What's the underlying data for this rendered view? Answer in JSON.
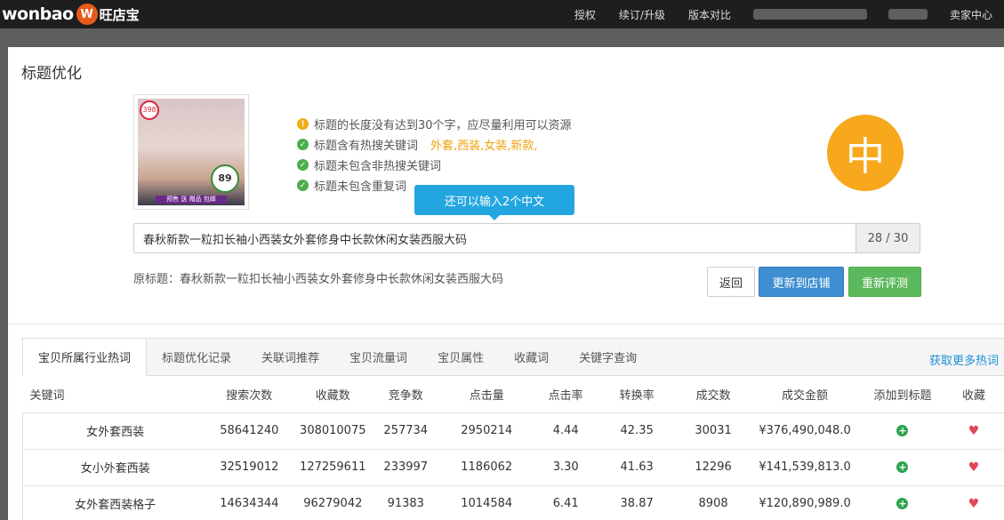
{
  "brand": {
    "logo_text": "wonbao",
    "logo_badge": "W",
    "logo_cn": "旺店宝"
  },
  "nav": {
    "items": [
      "授权",
      "续订/升级",
      "版本对比"
    ],
    "seller_center": "卖家中心"
  },
  "modal": {
    "title": "标题优化",
    "product_badges": {
      "tag": "398",
      "price": "89",
      "strip": "预售 送 赠品 包邮"
    },
    "checks": [
      {
        "status": "warn",
        "text": "标题的长度没有达到30个字，应尽量利用可以资源",
        "keywords": ""
      },
      {
        "status": "ok",
        "text": "标题含有热搜关键词",
        "keywords": "外套,西装,女装,新款,"
      },
      {
        "status": "ok",
        "text": "标题未包含非热搜关键词",
        "keywords": ""
      },
      {
        "status": "ok",
        "text": "标题未包含重复词",
        "keywords": ""
      }
    ],
    "grade": "中",
    "tooltip": "还可以输入2个中文",
    "title_value": "春秋新款一粒扣长袖小西装女外套修身中长款休闲女装西服大码",
    "counter": "28 / 30",
    "original_title": "原标题：春秋新款一粒扣长袖小西装女外套修身中长款休闲女装西服大码",
    "buttons": {
      "back": "返回",
      "update": "更新到店铺",
      "reeval": "重新评测"
    }
  },
  "tabs": [
    "宝贝所属行业热词",
    "标题优化记录",
    "关联词推荐",
    "宝贝流量词",
    "宝贝属性",
    "收藏词",
    "关键字查询"
  ],
  "more_link": "获取更多热词",
  "table": {
    "headers": [
      "关键词",
      "搜索次数",
      "收藏数",
      "竞争数",
      "点击量",
      "点击率",
      "转换率",
      "成交数",
      "成交金额",
      "添加到标题",
      "收藏"
    ],
    "rows": [
      [
        "女外套西装",
        "58641240",
        "308010075",
        "257734",
        "2950214",
        "4.44",
        "42.35",
        "30031",
        "¥376,490,048.0"
      ],
      [
        "女小外套西装",
        "32519012",
        "127259611",
        "233997",
        "1186062",
        "3.30",
        "41.63",
        "12296",
        "¥141,539,813.0"
      ],
      [
        "女外套西装格子",
        "14634344",
        "96279042",
        "91383",
        "1014584",
        "6.41",
        "38.87",
        "8908",
        "¥120,890,989.0"
      ]
    ]
  },
  "colors": {
    "accent": "#f7a81c",
    "primary": "#3e8fd1",
    "success": "#5cb85c",
    "tooltip": "#23a6e0",
    "link": "#1d8fd6"
  }
}
